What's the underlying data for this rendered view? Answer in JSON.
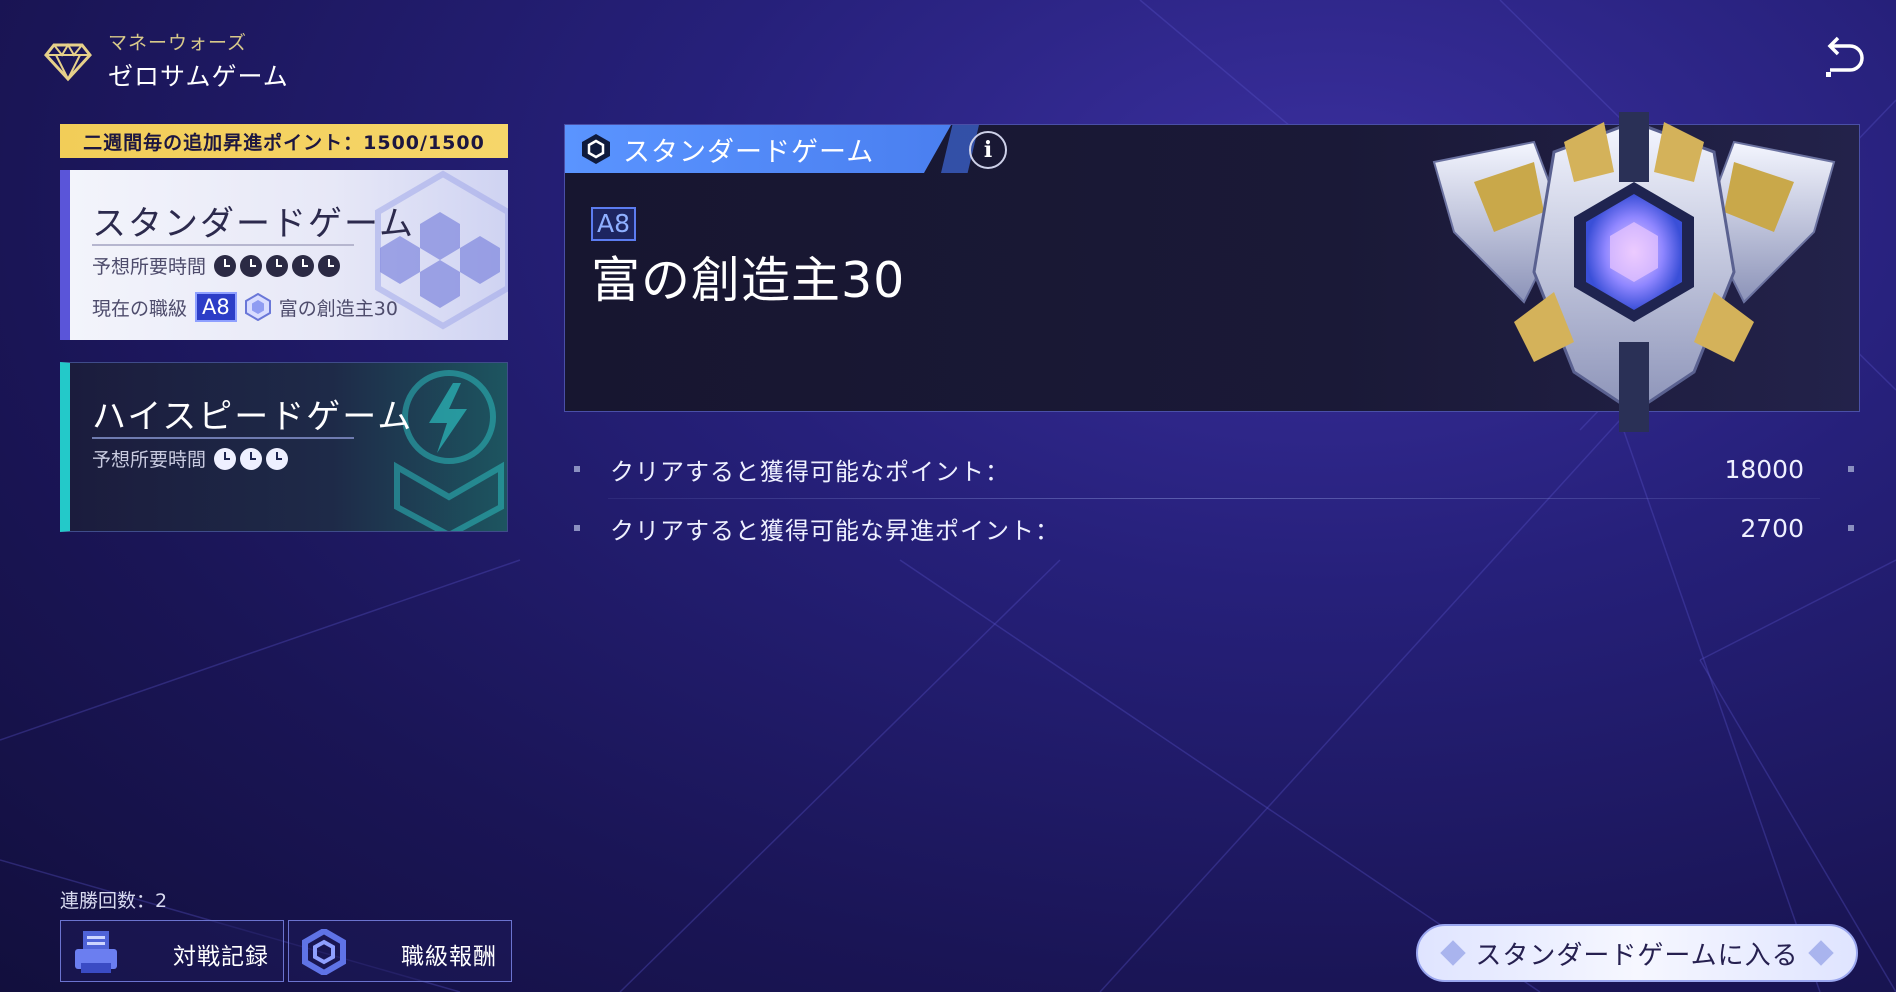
{
  "header": {
    "subtitle": "マネーウォーズ",
    "title": "ゼロサムゲーム"
  },
  "bonus_bar": {
    "text": "二週間毎の追加昇進ポイント：1500/1500"
  },
  "modes": [
    {
      "name": "スタンダードゲーム",
      "time_label": "予想所要時間",
      "time_clocks": 5,
      "rank_label": "現在の職級",
      "rank_badge": "A8",
      "rank_name": "富の創造主30",
      "selected": true
    },
    {
      "name": "ハイスピードゲーム",
      "time_label": "予想所要時間",
      "time_clocks": 3,
      "selected": false
    }
  ],
  "panel": {
    "tab_title": "スタンダードゲーム",
    "info_icon": "i",
    "rank_badge": "A8",
    "rank_name": "富の創造主30"
  },
  "stats": [
    {
      "label": "クリアすると獲得可能なポイント：",
      "value": "18000"
    },
    {
      "label": "クリアすると獲得可能な昇進ポイント：",
      "value": "2700"
    }
  ],
  "streak": {
    "text": "連勝回数：2"
  },
  "buttons": {
    "history": "対戦記録",
    "rank_reward": "職級報酬",
    "enter": "スタンダードゲームに入る"
  },
  "icons": {
    "logo": "diamond-logo-icon",
    "back": "back-arrow-icon",
    "tab": "hexagon-rank-icon",
    "history": "printer-record-icon",
    "rank_reward": "hexagon-gear-icon"
  },
  "colors": {
    "background": "#26207a",
    "bonus_bar": "#f2cd58",
    "standard_accent": "#5a55d9",
    "highspeed_accent": "#23c9c9",
    "tab_blue": "#5a94ff"
  }
}
